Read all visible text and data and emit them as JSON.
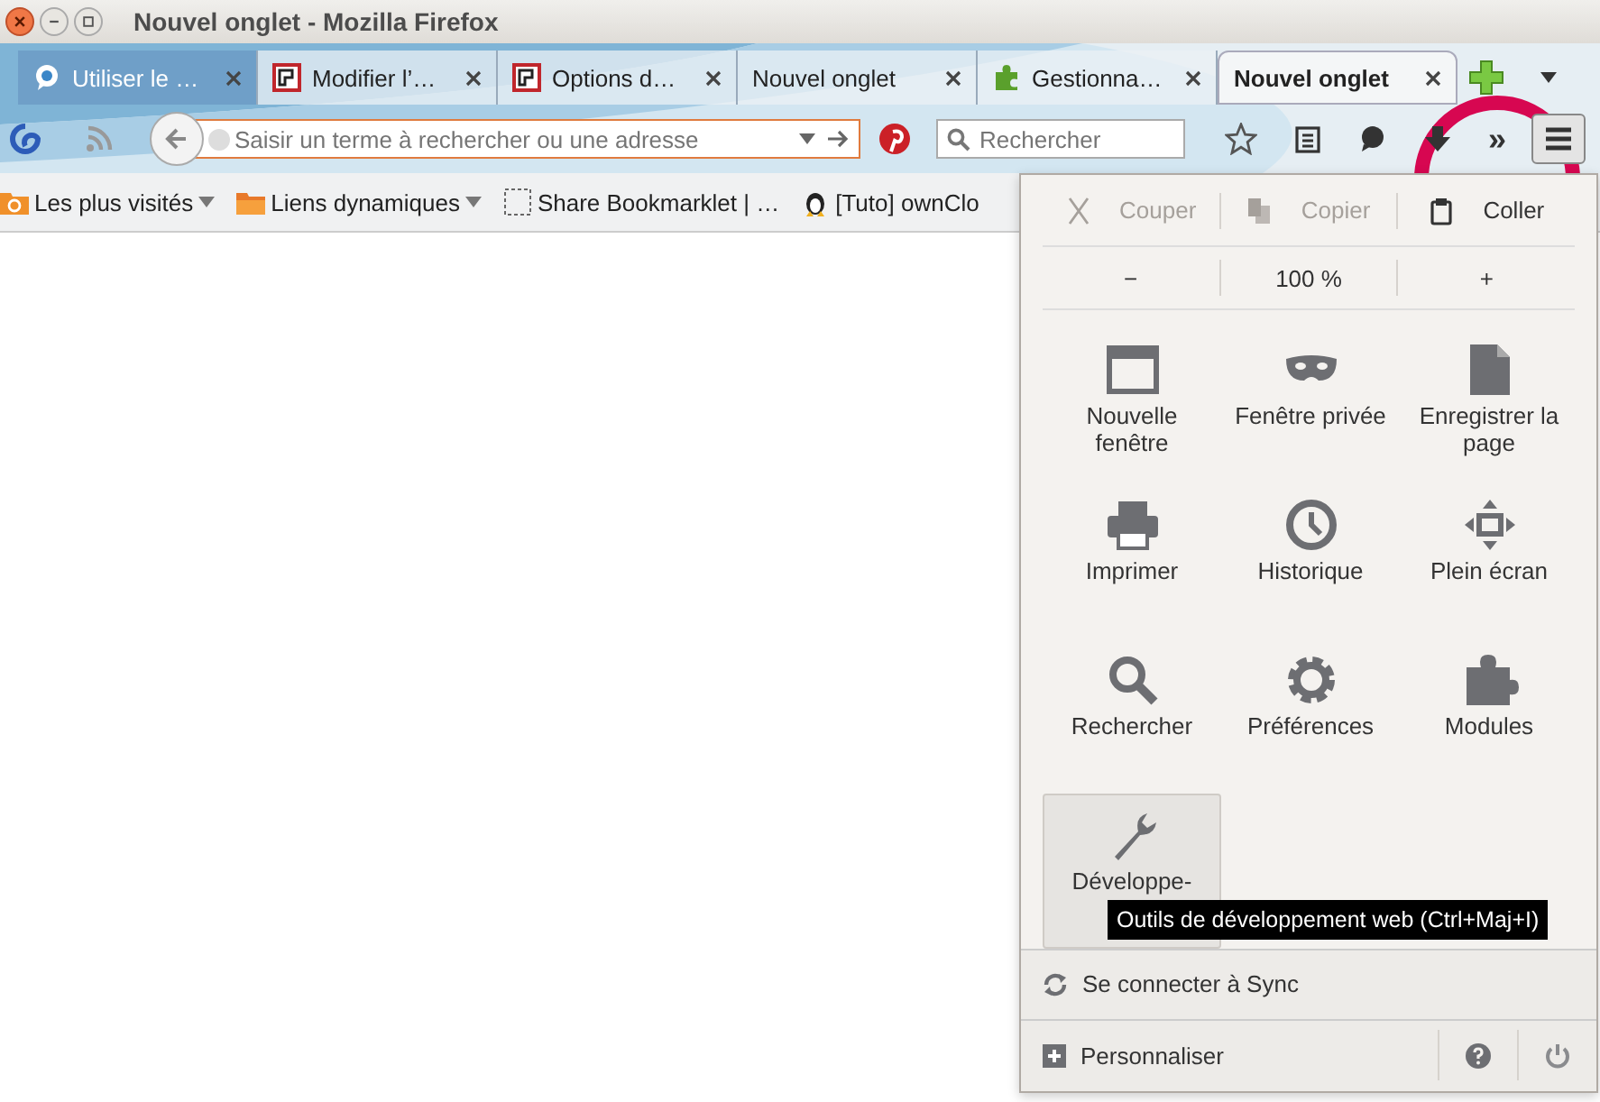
{
  "window": {
    "title": "Nouvel onglet - Mozilla Firefox"
  },
  "tabs": [
    {
      "label": "Utiliser le …",
      "selected": false,
      "kind": "chat"
    },
    {
      "label": "Modifier l’…",
      "selected": false,
      "kind": "framed"
    },
    {
      "label": "Options d…",
      "selected": false,
      "kind": "framed"
    },
    {
      "label": "Nouvel onglet",
      "selected": false,
      "kind": "plain"
    },
    {
      "label": "Gestionna…",
      "selected": false,
      "kind": "puzzle"
    },
    {
      "label": "Nouvel onglet",
      "selected": true,
      "kind": "plain"
    }
  ],
  "navbar": {
    "address_placeholder": "Saisir un terme à rechercher ou une adresse",
    "search_placeholder": "Rechercher",
    "overflow": "»"
  },
  "bookmarks": [
    {
      "label": "Les plus visités",
      "kind": "smart-folder"
    },
    {
      "label": "Liens dynamiques",
      "kind": "folder"
    },
    {
      "label": "Share Bookmarklet | …",
      "kind": "page"
    },
    {
      "label": "[Tuto] ownClo",
      "kind": "penguin"
    }
  ],
  "menu": {
    "edit": [
      {
        "label": "Couper",
        "kind": "cut",
        "disabled": true
      },
      {
        "label": "Copier",
        "kind": "copy",
        "disabled": true
      },
      {
        "label": "Coller",
        "kind": "paste",
        "disabled": false
      }
    ],
    "zoom": {
      "out": "−",
      "level": "100 %",
      "in": "+"
    },
    "items": [
      {
        "label": "Nouvelle fenêtre",
        "kind": "window",
        "highlighted": false
      },
      {
        "label": "Fenêtre privée",
        "kind": "mask",
        "highlighted": false
      },
      {
        "label": "Enregistrer la page",
        "kind": "page",
        "highlighted": false
      },
      {
        "label": "Imprimer",
        "kind": "printer",
        "highlighted": false
      },
      {
        "label": "Historique",
        "kind": "clock",
        "highlighted": false
      },
      {
        "label": "Plein écran",
        "kind": "fullscreen",
        "highlighted": false
      },
      {
        "label": "Rechercher",
        "kind": "search",
        "highlighted": false
      },
      {
        "label": "Préférences",
        "kind": "gear",
        "highlighted": false
      },
      {
        "label": "Modules",
        "kind": "puzzle",
        "highlighted": false
      },
      {
        "label": "Développe-",
        "kind": "wrench",
        "highlighted": true
      }
    ],
    "sync": "Se connecter à Sync",
    "customize": "Personnaliser"
  },
  "tooltip": "Outils de développement web (Ctrl+Maj+I)"
}
